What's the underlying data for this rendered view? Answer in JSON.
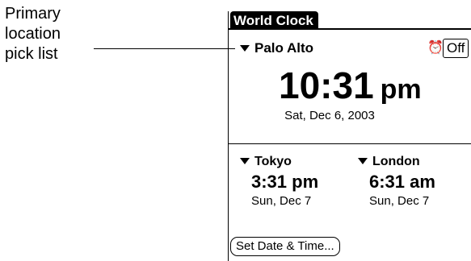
{
  "callout": {
    "lines": [
      "Primary",
      "location",
      "pick list"
    ]
  },
  "app": {
    "title": "World Clock",
    "primary": {
      "city": "Palo Alto",
      "time": "10:31",
      "ampm": "pm",
      "date": "Sat, Dec 6, 2003"
    },
    "alarm": {
      "icon": "alarm-clock-icon",
      "value": "Off"
    },
    "secondary": [
      {
        "city": "Tokyo",
        "time": "3:31 pm",
        "date": "Sun, Dec 7"
      },
      {
        "city": "London",
        "time": "6:31 am",
        "date": "Sun, Dec 7"
      }
    ],
    "set_button": "Set Date & Time..."
  }
}
